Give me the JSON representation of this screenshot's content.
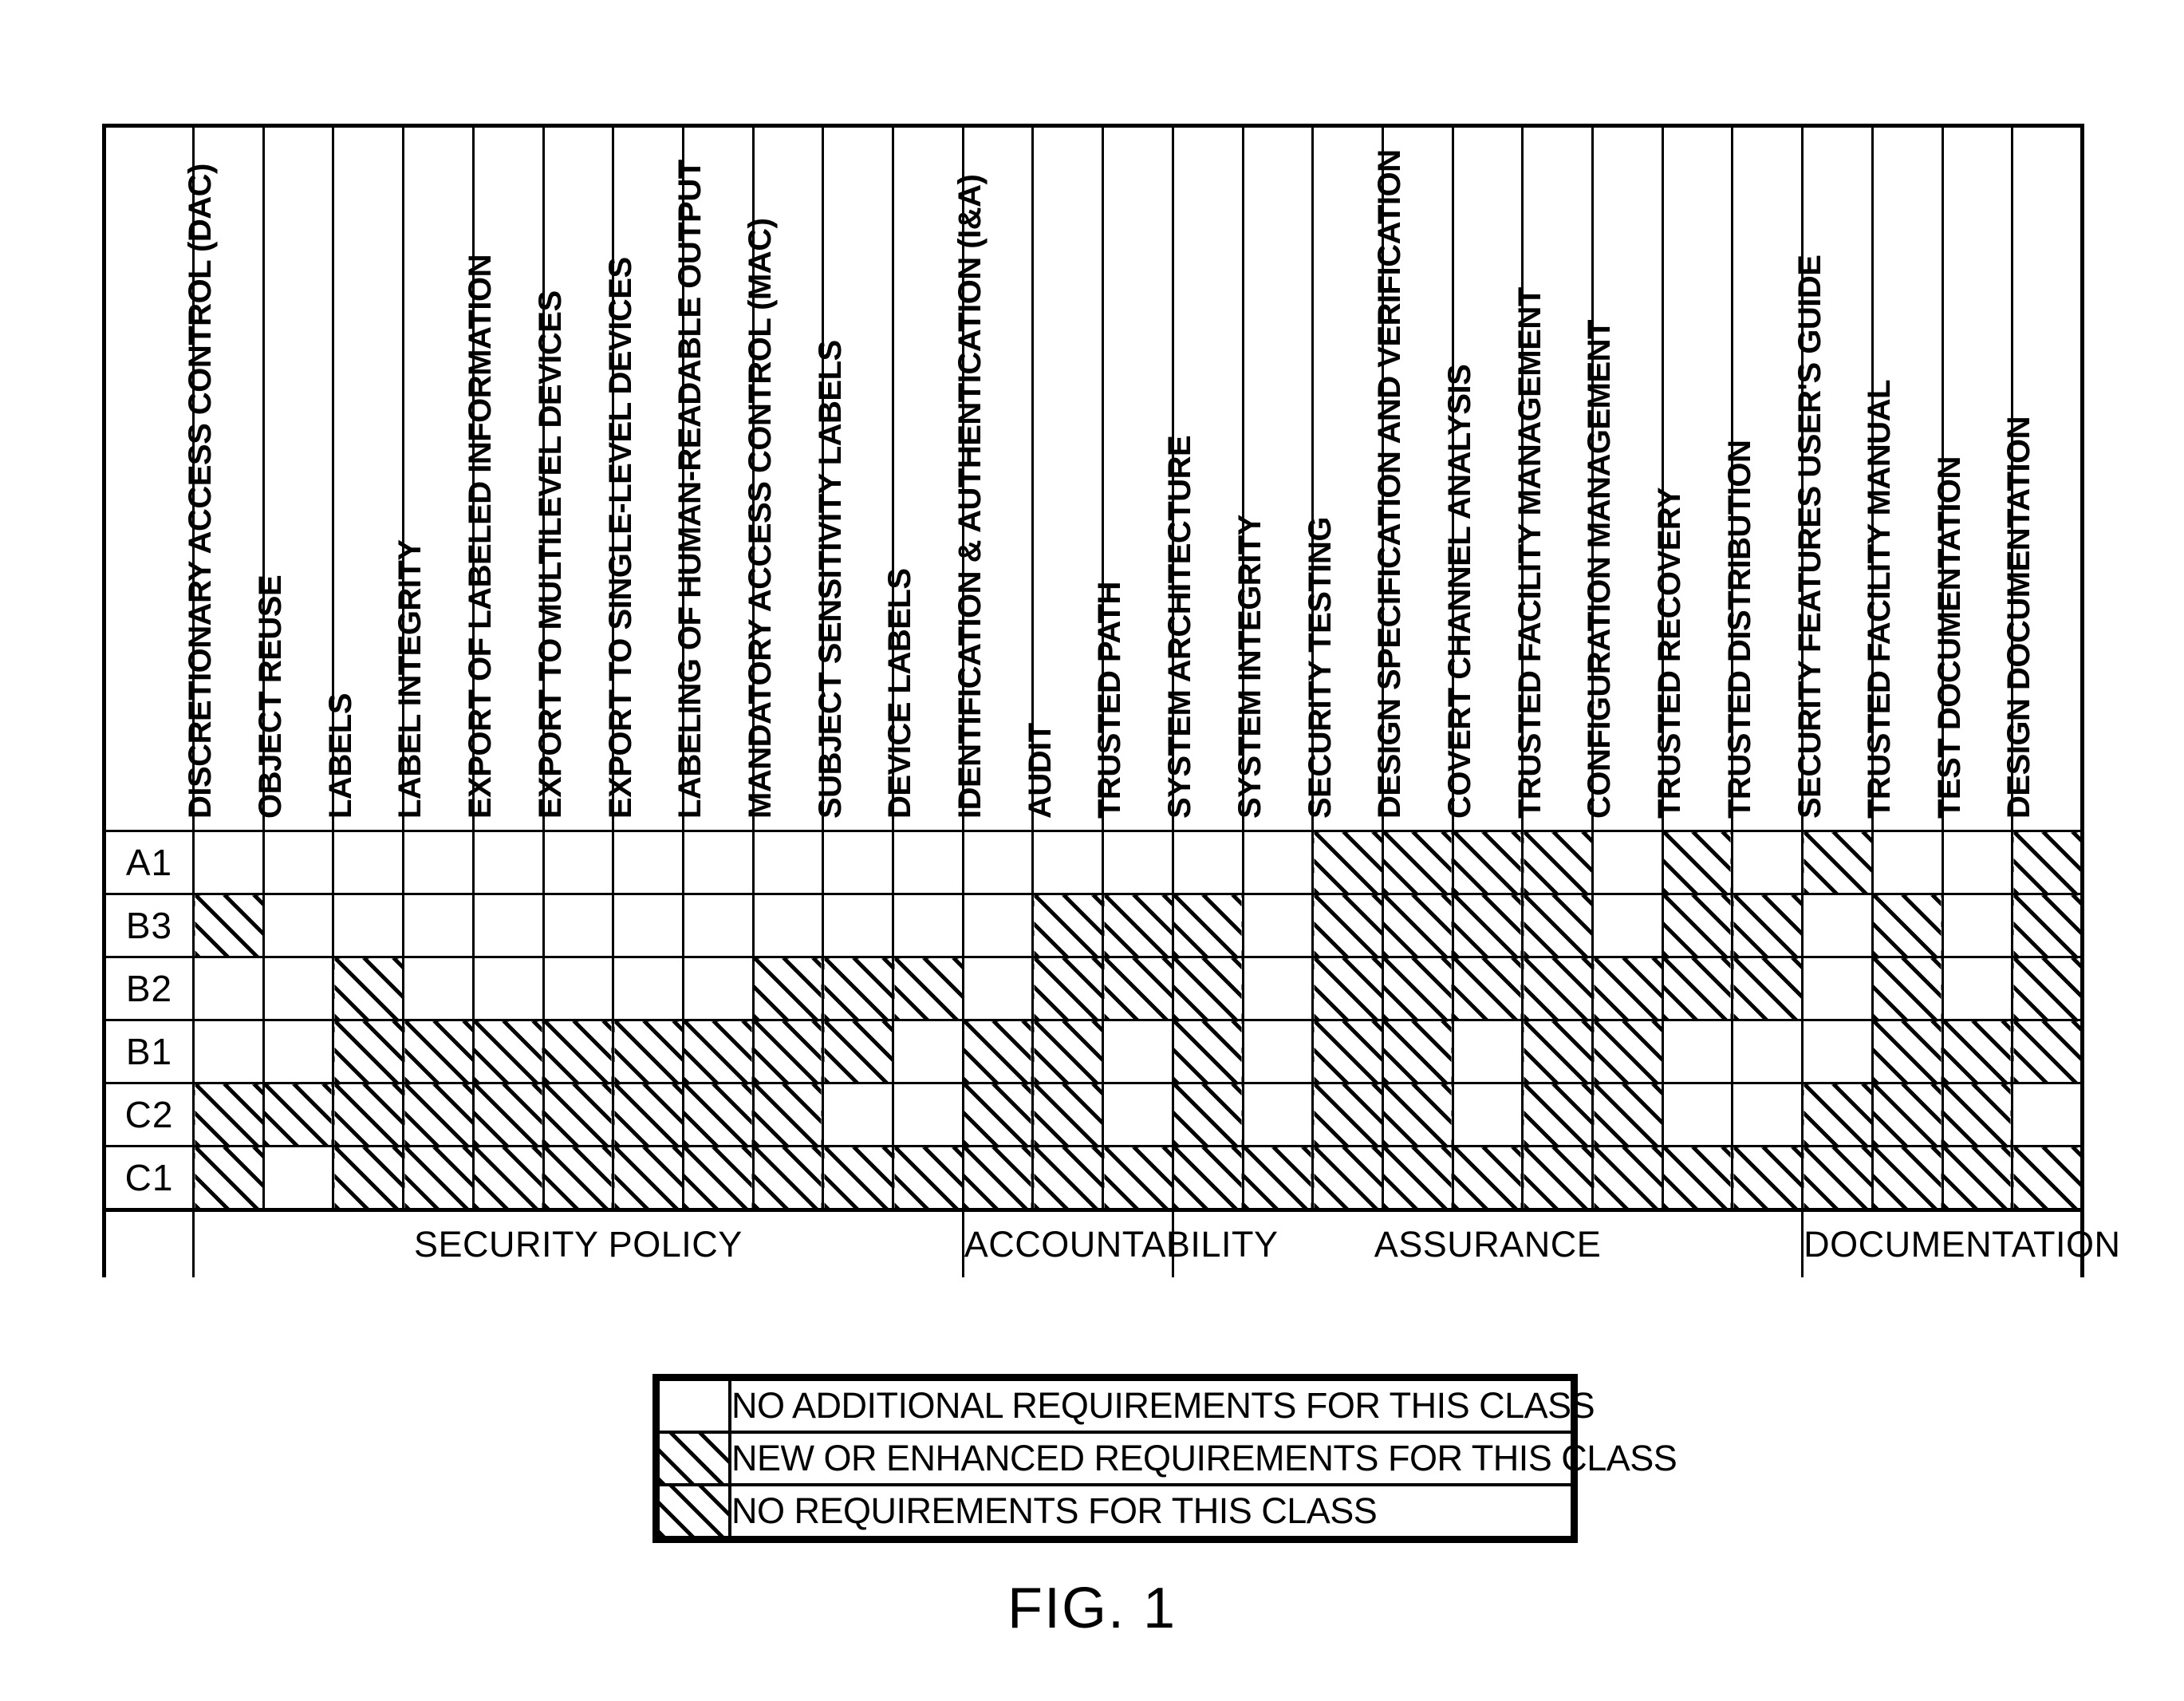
{
  "figure": {
    "caption": "FIG. 1"
  },
  "matrix": {
    "columns": [
      {
        "label": "DISCRETIONARY ACCESS CONTROL (DAC)",
        "group": "SECURITY POLICY"
      },
      {
        "label": "OBJECT REUSE",
        "group": "SECURITY POLICY"
      },
      {
        "label": "LABELS",
        "group": "SECURITY POLICY"
      },
      {
        "label": "LABEL INTEGRITY",
        "group": "SECURITY POLICY"
      },
      {
        "label": "EXPORT OF LABELED INFORMATION",
        "group": "SECURITY POLICY"
      },
      {
        "label": "EXPORT TO MULTILEVEL DEVICES",
        "group": "SECURITY POLICY"
      },
      {
        "label": "EXPORT TO SINGLE-LEVEL DEVICES",
        "group": "SECURITY POLICY"
      },
      {
        "label": "LABELING OF HUMAN-READABLE OUTPUT",
        "group": "SECURITY POLICY"
      },
      {
        "label": "MANDATORY ACCESS CONTROL (MAC)",
        "group": "SECURITY POLICY"
      },
      {
        "label": "SUBJECT SENSITIVITY LABELS",
        "group": "SECURITY POLICY"
      },
      {
        "label": "DEVICE LABELS",
        "group": "SECURITY POLICY"
      },
      {
        "label": "IDENTIFICATION & AUTHENTICATION (I&A)",
        "group": "ACCOUNTABILITY"
      },
      {
        "label": "AUDIT",
        "group": "ACCOUNTABILITY"
      },
      {
        "label": "TRUSTED PATH",
        "group": "ACCOUNTABILITY"
      },
      {
        "label": "SYSTEM ARCHITECTURE",
        "group": "ASSURANCE"
      },
      {
        "label": "SYSTEM INTEGRITY",
        "group": "ASSURANCE"
      },
      {
        "label": "SECURITY TESTING",
        "group": "ASSURANCE"
      },
      {
        "label": "DESIGN SPECIFICATION AND VERIFICATION",
        "group": "ASSURANCE"
      },
      {
        "label": "COVERT CHANNEL ANALYSIS",
        "group": "ASSURANCE"
      },
      {
        "label": "TRUSTED FACILITY MANAGEMENT",
        "group": "ASSURANCE"
      },
      {
        "label": "CONFIGURATION MANAGEMENT",
        "group": "ASSURANCE"
      },
      {
        "label": "TRUSTED RECOVERY",
        "group": "ASSURANCE"
      },
      {
        "label": "TRUSTED DISTRIBUTION",
        "group": "ASSURANCE"
      },
      {
        "label": "SECURITY FEATURES USER'S GUIDE",
        "group": "DOCUMENTATION"
      },
      {
        "label": "TRUSTED FACILITY MANUAL",
        "group": "DOCUMENTATION"
      },
      {
        "label": "TEST DOCUMENTATION",
        "group": "DOCUMENTATION"
      },
      {
        "label": "DESIGN DOCUMENTATION",
        "group": "DOCUMENTATION"
      }
    ],
    "groups": [
      {
        "label": "SECURITY POLICY",
        "span": 11
      },
      {
        "label": "ACCOUNTABILITY",
        "span": 3
      },
      {
        "label": "ASSURANCE",
        "span": 9
      },
      {
        "label": "DOCUMENTATION",
        "span": 4
      }
    ],
    "rows": [
      {
        "label": "A1",
        "cells": [
          0,
          0,
          0,
          0,
          0,
          0,
          0,
          0,
          0,
          0,
          0,
          0,
          0,
          0,
          0,
          0,
          1,
          1,
          1,
          1,
          0,
          1,
          0,
          1,
          0,
          0,
          1,
          1
        ]
      },
      {
        "label": "B3",
        "cells": [
          1,
          0,
          0,
          0,
          0,
          0,
          0,
          0,
          0,
          0,
          0,
          0,
          1,
          1,
          1,
          0,
          1,
          1,
          1,
          1,
          0,
          1,
          1,
          0,
          1,
          0,
          1
        ]
      },
      {
        "label": "B2",
        "cells": [
          0,
          0,
          1,
          0,
          0,
          0,
          0,
          0,
          1,
          1,
          1,
          0,
          1,
          1,
          1,
          0,
          1,
          1,
          1,
          1,
          1,
          1,
          1,
          0,
          1,
          0,
          1
        ]
      },
      {
        "label": "B1",
        "cells": [
          0,
          0,
          1,
          1,
          1,
          1,
          1,
          1,
          1,
          1,
          0,
          1,
          1,
          0,
          1,
          0,
          1,
          1,
          0,
          1,
          1,
          0,
          0,
          0,
          1,
          1,
          1
        ]
      },
      {
        "label": "C2",
        "cells": [
          1,
          1,
          1,
          1,
          1,
          1,
          1,
          1,
          1,
          0,
          0,
          1,
          1,
          0,
          1,
          0,
          1,
          1,
          0,
          1,
          1,
          0,
          0,
          1,
          1,
          1,
          0
        ]
      },
      {
        "label": "C1",
        "cells": [
          1,
          0,
          1,
          1,
          1,
          1,
          1,
          1,
          1,
          1,
          1,
          1,
          1,
          1,
          1,
          1,
          1,
          1,
          1,
          1,
          1,
          1,
          1,
          1,
          1,
          1,
          1
        ]
      }
    ]
  },
  "legend": {
    "items": [
      {
        "swatch": "none",
        "text": "NO ADDITIONAL REQUIREMENTS FOR THIS CLASS"
      },
      {
        "swatch": "hatch",
        "text": "NEW OR ENHANCED REQUIREMENTS FOR THIS CLASS"
      },
      {
        "swatch": "hatch",
        "text": "NO REQUIREMENTS FOR THIS CLASS"
      }
    ]
  }
}
